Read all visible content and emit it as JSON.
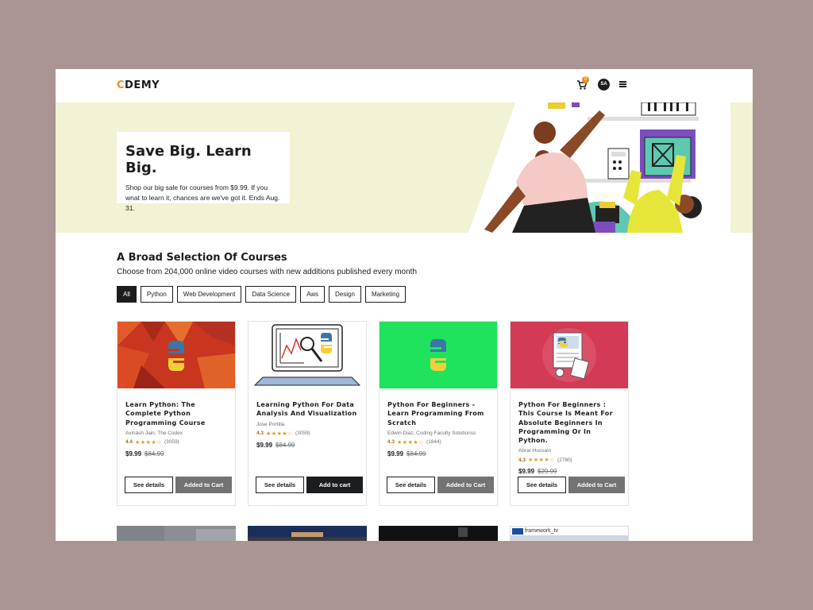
{
  "header": {
    "logo_accent": "C",
    "logo_rest": "DEMY",
    "cart_count": "0",
    "avatar_initials": "SA"
  },
  "hero": {
    "title": "Save Big. Learn Big.",
    "text": "Shop our big sale for courses from $9.99. If you wnat to learn it, chances are we've got it. Ends Aug. 31."
  },
  "section": {
    "title": "A Broad Selection Of Courses",
    "subtitle": "Choose from 204,000 online video courses with new additions published every month"
  },
  "filters": [
    "All",
    "Python",
    "Web Development",
    "Data Science",
    "Aws",
    "Design",
    "Marketing"
  ],
  "courses": [
    {
      "title": "Learn Python: The Complete Python Programming Course",
      "author": "Avinash Jain, The Codex",
      "rating": "4.4",
      "reviews": "(3059)",
      "price": "$9.99",
      "old_price": "$84.99",
      "details_label": "See details",
      "cart_label": "Added to Cart"
    },
    {
      "title": "Learning Python For Data Analysis And Visualization",
      "author": "Jose Portilla",
      "rating": "4.3",
      "reviews": "(3059)",
      "price": "$9.99",
      "old_price": "$84.99",
      "details_label": "See details",
      "cart_label": "Add to cart"
    },
    {
      "title": "Python For Beginners - Learn Programming From Scratch",
      "author": "Edwin Diaz, Coding Faculty Solutionss",
      "rating": "4.3",
      "reviews": "(1844)",
      "price": "$9.99",
      "old_price": "$84.99",
      "details_label": "See details",
      "cart_label": "Added to Cart"
    },
    {
      "title": "Python For Beginners : This Course Is Meant For Absolute Beginners In Programming Or In Python.",
      "author": "Abrar Hussain",
      "rating": "4.3",
      "reviews": "(2780)",
      "price": "$9.99",
      "old_price": "$29.99",
      "details_label": "See details",
      "cart_label": "Added to Cart"
    }
  ],
  "row2": {
    "fw_logo_text": "framework_tv"
  },
  "colors": {
    "accent": "#ef8b22",
    "hero_bg": "#f2f2d4",
    "page_bg": "#ab9594",
    "star": "#e59819"
  }
}
